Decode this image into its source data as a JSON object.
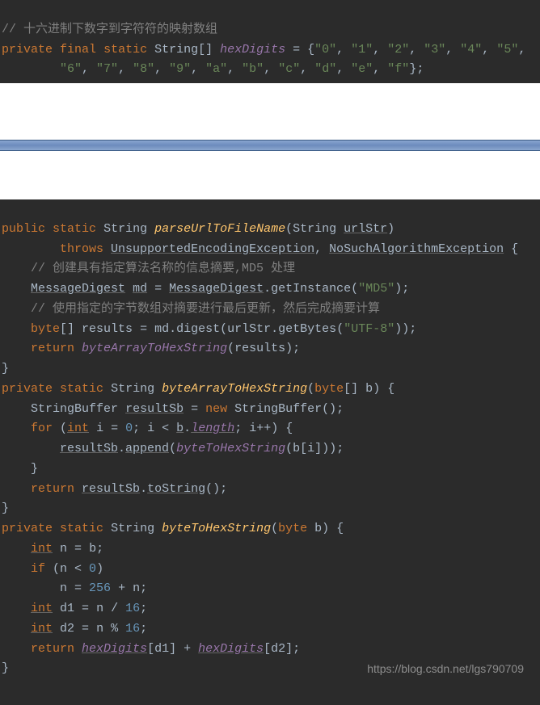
{
  "block1": {
    "c0": "// 十六进制下数字到字符符的映射数组",
    "kw_private": "private",
    "kw_final": "final",
    "kw_static": "static",
    "type_stringarr": "String[]",
    "field_hexDigits": "hexDigits",
    "eq": " = {",
    "d0": "\"0\"",
    "s": ", ",
    "d1": "\"1\"",
    "d2": "\"2\"",
    "d3": "\"3\"",
    "d4": "\"4\"",
    "d5": "\"5\"",
    "d6": "\"6\"",
    "d7": "\"7\"",
    "d8": "\"8\"",
    "d9": "\"9\"",
    "da": "\"a\"",
    "db": "\"b\"",
    "dc": "\"c\"",
    "dd": "\"d\"",
    "de": "\"e\"",
    "df": "\"f\"",
    "end": "};"
  },
  "block2": {
    "l1": {
      "kw_public": "public",
      "kw_static": "static",
      "type": "String",
      "mname": "parseUrlToFileName",
      "paren_o": "(",
      "ptype": "String ",
      "pvar": "urlStr",
      "paren_c": ")"
    },
    "l2": {
      "kw_throws": "throws",
      "ex1": "UnsupportedEncodingException",
      "comma": ", ",
      "ex2": "NoSuchAlgorithmException",
      "brace": " {"
    },
    "l3": "// 创建具有指定算法名称的信息摘要,MD5 处理",
    "l4": {
      "type": "MessageDigest",
      "var": "md",
      "eq": " = ",
      "cls": "MessageDigest",
      "dot": ".",
      "call": "getInstance",
      "p": "(",
      "arg": "\"MD5\"",
      "c": ");"
    },
    "l5": "// 使用指定的字节数组对摘要进行最后更新，然后完成摘要计算",
    "l6": {
      "kw_byte": "byte",
      "arr": "[] ",
      "var": "results",
      "eq": " = ",
      "obj": "md",
      "dot": ".",
      "m": "digest",
      "p": "(",
      "obj2": "urlStr",
      "dot2": ".",
      "m2": "getBytes",
      "p2": "(",
      "arg": "\"UTF-8\"",
      "c": "));"
    },
    "l7": {
      "kw_return": "return",
      "call": "byteArrayToHexString",
      "p": "(",
      "arg": "results",
      "c": ");"
    },
    "l8": "}",
    "l9": {
      "kw_private": "private",
      "kw_static": "static",
      "type": "String",
      "mname": "byteArrayToHexString",
      "p": "(",
      "ptype": "byte",
      "arr": "[] ",
      "pvar": "b",
      "c": ") {"
    },
    "l10": {
      "type": "StringBuffer",
      "var": "resultSb",
      "eq": " = ",
      "kw_new": "new",
      "ctor": " StringBuffer",
      "p": "();"
    },
    "l11": {
      "kw_for": "for",
      "p": " (",
      "kw_int": "int",
      "v": " i",
      "eq": " = ",
      "n0": "0",
      "sc": "; ",
      "v2": "i",
      "lt": " < ",
      "obj": "b",
      "dot": ".",
      "len": "length",
      "sc2": "; ",
      "v3": "i",
      "inc": "++) {"
    },
    "l12": {
      "obj": "resultSb",
      "dot": ".",
      "m": "append",
      "p": "(",
      "call": "byteToHexString",
      "p2": "(",
      "obj2": "b",
      "br": "[",
      "idx": "i",
      "br2": "]",
      "c": "));"
    },
    "l13": "}",
    "l14": {
      "kw_return": "return",
      "obj": "resultSb",
      "dot": ".",
      "m": "toString",
      "p": "();"
    },
    "l15": "}",
    "l16": {
      "kw_private": "private",
      "kw_static": "static",
      "type": "String",
      "mname": "byteToHexString",
      "p": "(",
      "ptype": "byte",
      "pvar": " b",
      "c": ") {"
    },
    "l17": {
      "kw_int": "int",
      "v": " n",
      "eq": " = ",
      "v2": "b",
      "sc": ";"
    },
    "l18": {
      "kw_if": "if",
      "p": " (n < ",
      "n": "0",
      "c": ")"
    },
    "l19": {
      "v": "n",
      "eq": " = ",
      "n": "256",
      "plus": " + ",
      "v2": "n",
      "sc": ";"
    },
    "l20": {
      "kw_int": "int",
      "v": " d1",
      "eq": " = ",
      "v2": "n / ",
      "n": "16",
      "sc": ";"
    },
    "l21": {
      "kw_int": "int",
      "v": " d2",
      "eq": " = ",
      "v2": "n % ",
      "n": "16",
      "sc": ";"
    },
    "l22": {
      "kw_return": "return",
      "f": "hexDigits",
      "b1": "[d1]",
      "plus": " + ",
      "f2": "hexDigits",
      "b2": "[d2]",
      "sc": ";"
    },
    "l23": "}"
  },
  "watermark": "https://blog.csdn.net/lgs790709"
}
